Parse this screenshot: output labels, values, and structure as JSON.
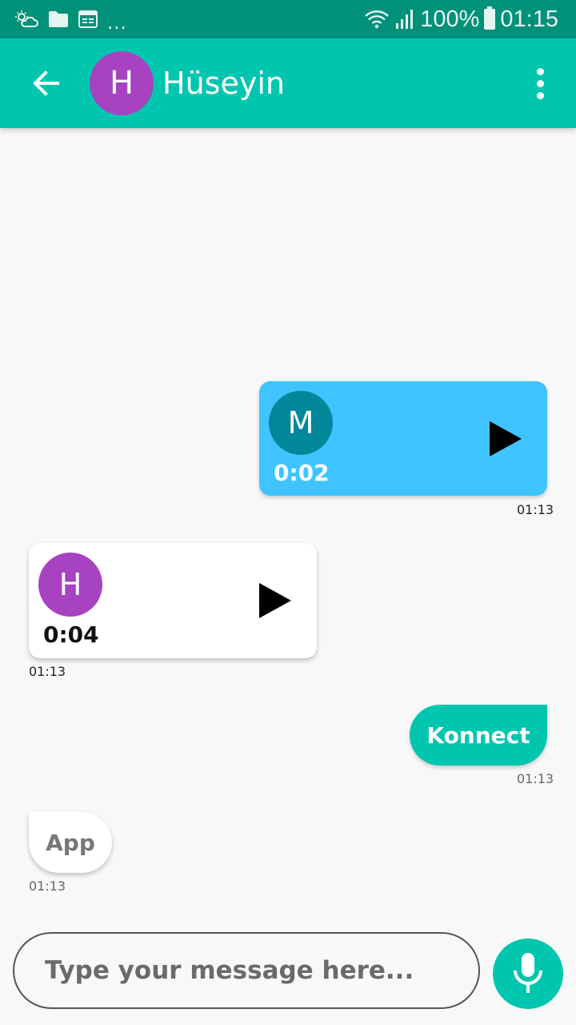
{
  "status_bar": {
    "overflow_indicator": "...",
    "battery": "100%",
    "time": "01:15",
    "icons": [
      "weather-icon",
      "folder-icon",
      "calendar-icon",
      "wifi-icon",
      "signal-icon",
      "battery-icon"
    ]
  },
  "header": {
    "avatar_initial": "H",
    "contact_name": "Hüseyin",
    "icons": [
      "back-arrow-icon",
      "more-vert-icon"
    ]
  },
  "messages": [
    {
      "type": "voice",
      "direction": "outgoing",
      "avatar_initial": "M",
      "duration": "0:02",
      "time": "01:13"
    },
    {
      "type": "voice",
      "direction": "incoming",
      "avatar_initial": "H",
      "duration": "0:04",
      "time": "01:13"
    },
    {
      "type": "text",
      "direction": "outgoing",
      "text": "Konnect",
      "time": "01:13"
    },
    {
      "type": "text",
      "direction": "incoming",
      "text": "App",
      "time": "01:13"
    }
  ],
  "composer": {
    "placeholder": "Type your message here...",
    "mic_icon": "microphone-icon"
  },
  "colors": {
    "status_bar": "#00917a",
    "app_bar": "#00c6b0",
    "outgoing_voice": "#40c4ff",
    "outgoing_text": "#00c6b0",
    "avatar_h": "#a743c1",
    "avatar_m": "#00879a"
  }
}
